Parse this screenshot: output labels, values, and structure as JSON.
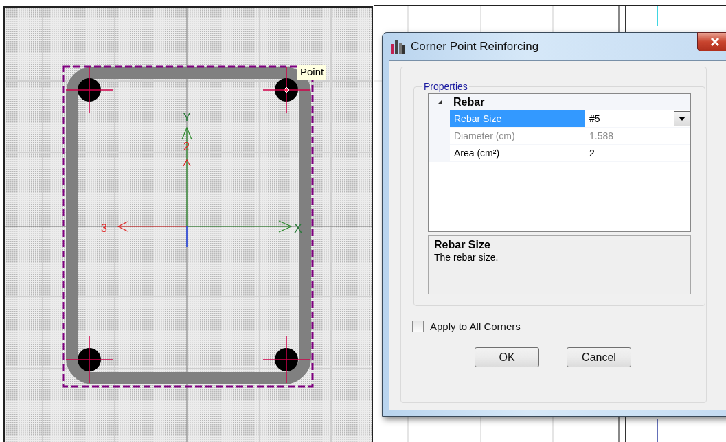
{
  "canvas": {
    "axes": [
      {
        "kind": "x",
        "label": "X"
      },
      {
        "kind": "y",
        "label": "Y"
      },
      {
        "kind": "local2",
        "label": "2"
      },
      {
        "kind": "local3",
        "label": "3"
      }
    ],
    "bars": [
      {
        "selected": false
      },
      {
        "selected": true
      },
      {
        "selected": false
      },
      {
        "selected": false
      }
    ],
    "tooltip": "Point"
  },
  "dialog": {
    "title": "Corner Point Reinforcing",
    "group": "Properties",
    "category": {
      "label": "Rebar",
      "expanded": true
    },
    "rows": [
      {
        "label": "Rebar Size",
        "value": "#5",
        "selected": true,
        "disabled": false,
        "kind": "dropdown"
      },
      {
        "label": "Diameter (cm)",
        "value": "1.588",
        "selected": false,
        "disabled": true,
        "kind": "text"
      },
      {
        "label": "Area (cm²)",
        "value": "2",
        "selected": false,
        "disabled": false,
        "kind": "text"
      }
    ],
    "description": {
      "title": "Rebar Size",
      "text": "The rebar size."
    },
    "apply_all": {
      "label": "Apply to All Corners",
      "checked": false
    },
    "buttons": [
      "OK",
      "Cancel"
    ]
  }
}
